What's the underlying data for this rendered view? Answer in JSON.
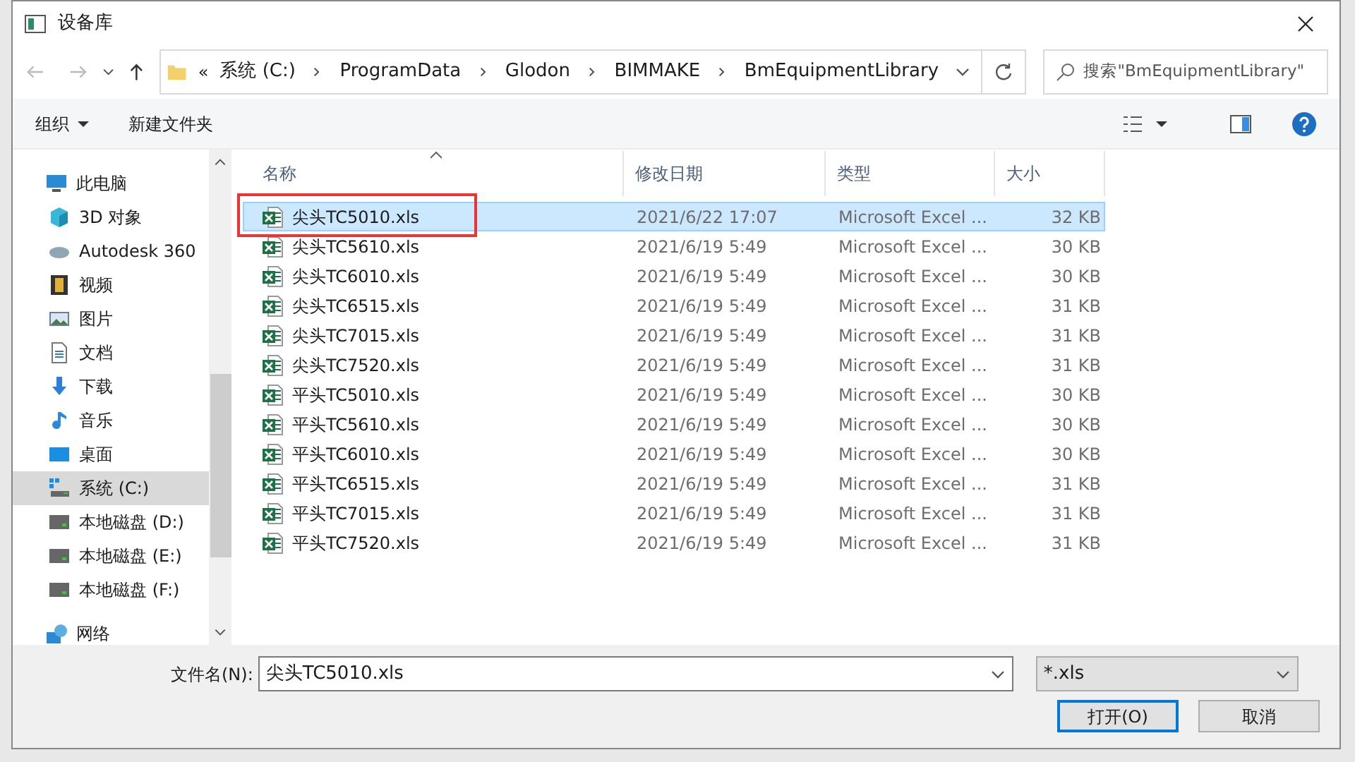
{
  "window": {
    "title": "设备库"
  },
  "address": {
    "overflow": "«",
    "crumbs": [
      "系统 (C:)",
      "ProgramData",
      "Glodon",
      "BIMMAKE",
      "BmEquipmentLibrary"
    ]
  },
  "search": {
    "placeholder": "搜索\"BmEquipmentLibrary\""
  },
  "toolbar": {
    "organize": "组织",
    "new_folder": "新建文件夹"
  },
  "sidebar": {
    "items": [
      {
        "label": "此电脑",
        "kind": "pc",
        "selected": false,
        "children": [
          {
            "label": "3D 对象",
            "kind": "cube",
            "selected": false
          },
          {
            "label": "Autodesk 360",
            "kind": "cloud",
            "selected": false
          },
          {
            "label": "视频",
            "kind": "video",
            "selected": false
          },
          {
            "label": "图片",
            "kind": "image",
            "selected": false
          },
          {
            "label": "文档",
            "kind": "doc",
            "selected": false
          },
          {
            "label": "下载",
            "kind": "download",
            "selected": false
          },
          {
            "label": "音乐",
            "kind": "music",
            "selected": false
          },
          {
            "label": "桌面",
            "kind": "desktop",
            "selected": false
          },
          {
            "label": "系统 (C:)",
            "kind": "sysdrive",
            "selected": true
          },
          {
            "label": "本地磁盘 (D:)",
            "kind": "drive",
            "selected": false
          },
          {
            "label": "本地磁盘 (E:)",
            "kind": "drive",
            "selected": false
          },
          {
            "label": "本地磁盘 (F:)",
            "kind": "drive",
            "selected": false
          }
        ]
      },
      {
        "label": "网络",
        "kind": "network",
        "selected": false
      }
    ]
  },
  "table": {
    "columns": [
      "名称",
      "修改日期",
      "类型",
      "大小"
    ],
    "rows": [
      {
        "name": "尖头TC5010.xls",
        "date": "2021/6/22 17:07",
        "type": "Microsoft Excel ...",
        "size": "32 KB",
        "selected": true,
        "marked": true
      },
      {
        "name": "尖头TC5610.xls",
        "date": "2021/6/19 5:49",
        "type": "Microsoft Excel ...",
        "size": "30 KB",
        "selected": false,
        "marked": false
      },
      {
        "name": "尖头TC6010.xls",
        "date": "2021/6/19 5:49",
        "type": "Microsoft Excel ...",
        "size": "30 KB",
        "selected": false,
        "marked": false
      },
      {
        "name": "尖头TC6515.xls",
        "date": "2021/6/19 5:49",
        "type": "Microsoft Excel ...",
        "size": "31 KB",
        "selected": false,
        "marked": false
      },
      {
        "name": "尖头TC7015.xls",
        "date": "2021/6/19 5:49",
        "type": "Microsoft Excel ...",
        "size": "31 KB",
        "selected": false,
        "marked": false
      },
      {
        "name": "尖头TC7520.xls",
        "date": "2021/6/19 5:49",
        "type": "Microsoft Excel ...",
        "size": "31 KB",
        "selected": false,
        "marked": false
      },
      {
        "name": "平头TC5010.xls",
        "date": "2021/6/19 5:49",
        "type": "Microsoft Excel ...",
        "size": "30 KB",
        "selected": false,
        "marked": false
      },
      {
        "name": "平头TC5610.xls",
        "date": "2021/6/19 5:49",
        "type": "Microsoft Excel ...",
        "size": "30 KB",
        "selected": false,
        "marked": false
      },
      {
        "name": "平头TC6010.xls",
        "date": "2021/6/19 5:49",
        "type": "Microsoft Excel ...",
        "size": "30 KB",
        "selected": false,
        "marked": false
      },
      {
        "name": "平头TC6515.xls",
        "date": "2021/6/19 5:49",
        "type": "Microsoft Excel ...",
        "size": "31 KB",
        "selected": false,
        "marked": false
      },
      {
        "name": "平头TC7015.xls",
        "date": "2021/6/19 5:49",
        "type": "Microsoft Excel ...",
        "size": "31 KB",
        "selected": false,
        "marked": false
      },
      {
        "name": "平头TC7520.xls",
        "date": "2021/6/19 5:49",
        "type": "Microsoft Excel ...",
        "size": "31 KB",
        "selected": false,
        "marked": false
      }
    ]
  },
  "footer": {
    "filename_label": "文件名(N):",
    "filename": "尖头TC5010.xls",
    "filter": "*.xls",
    "open": "打开(O)",
    "cancel": "取消"
  }
}
